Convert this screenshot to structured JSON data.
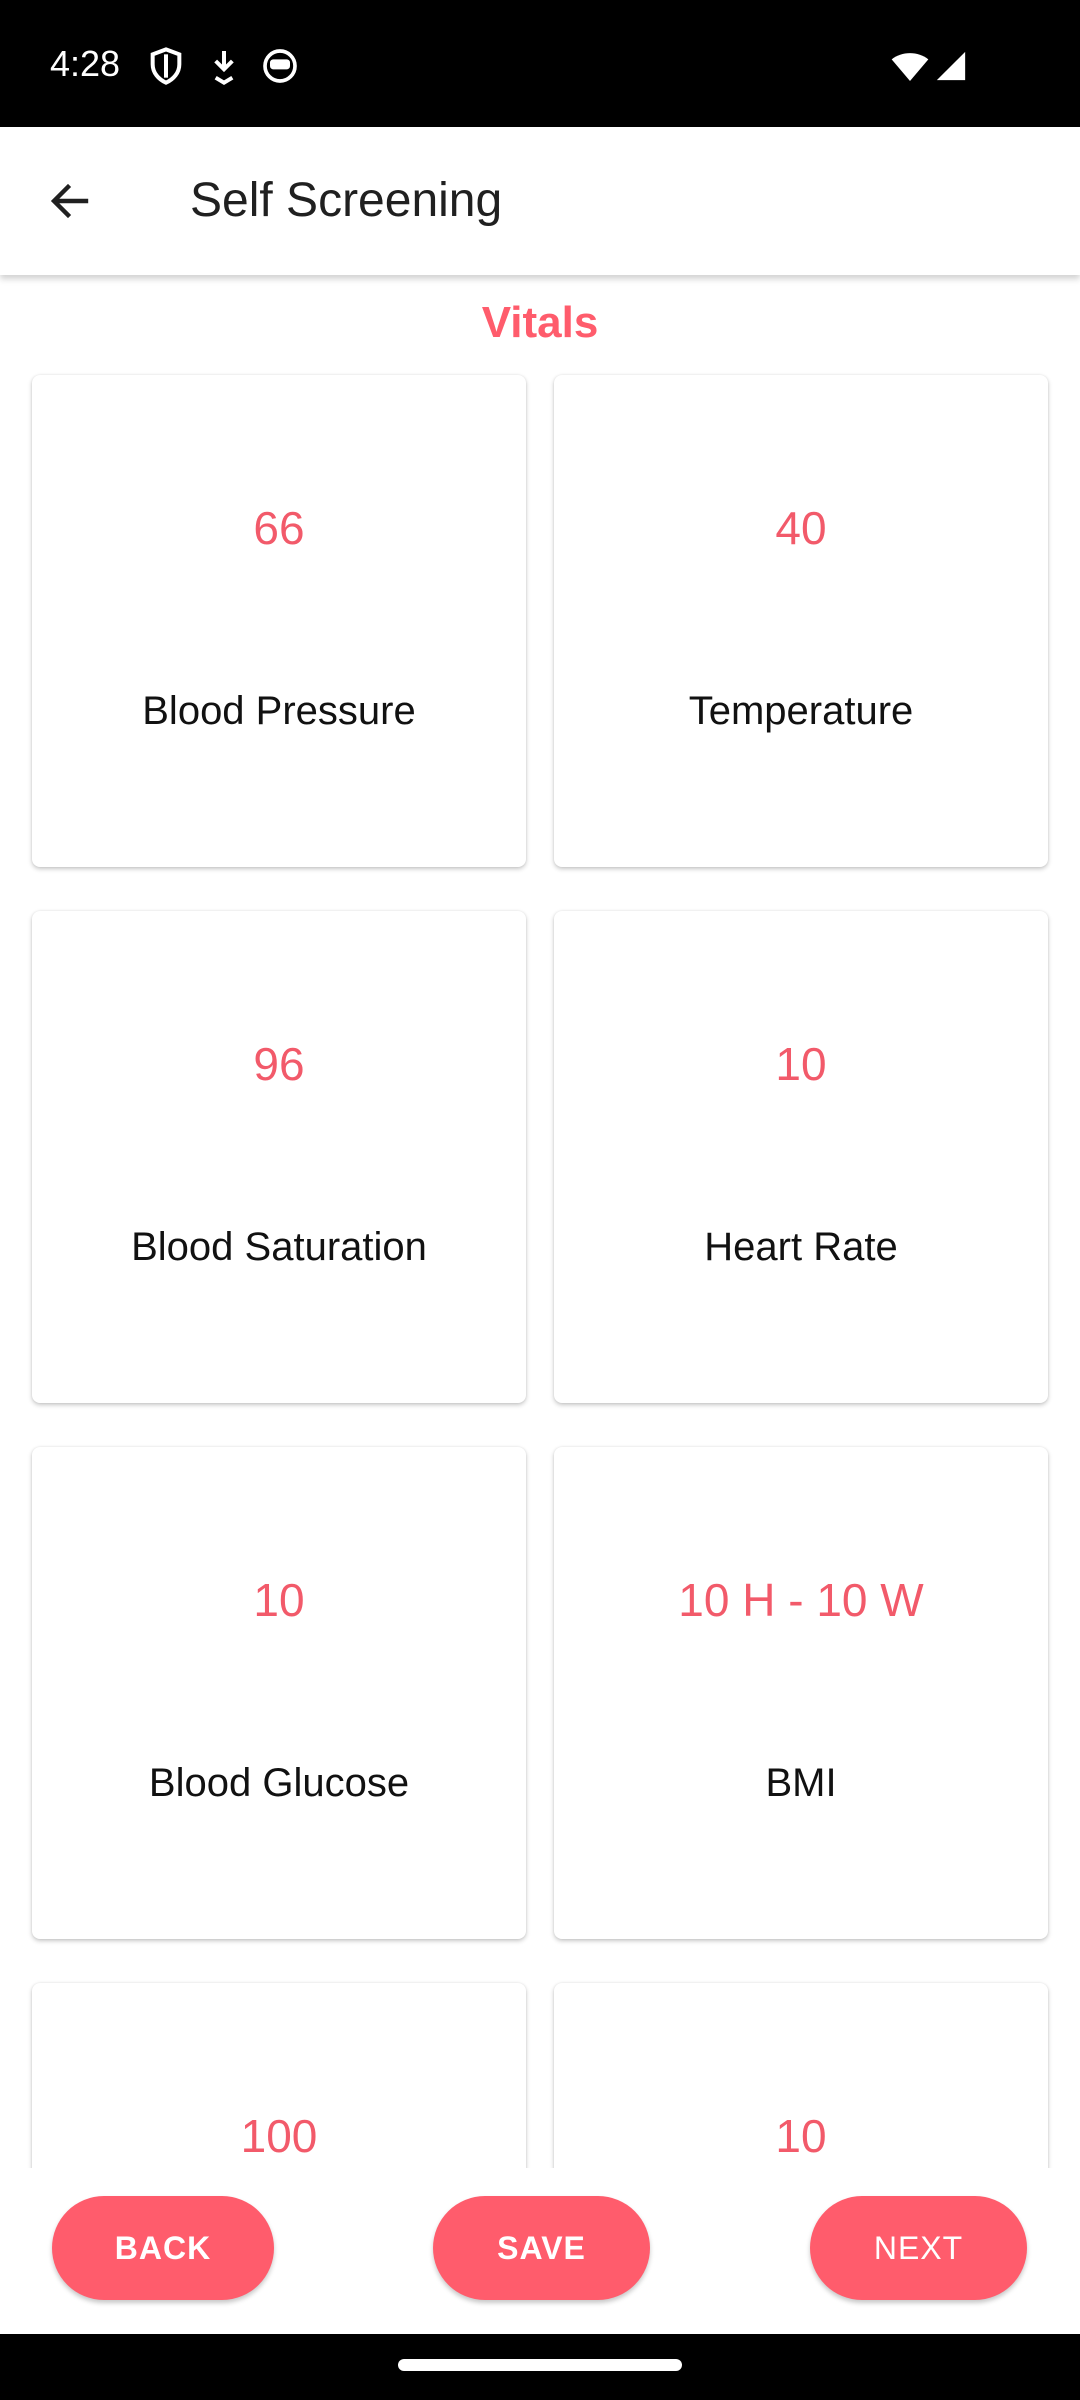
{
  "status_bar": {
    "time": "4:28",
    "icons": [
      "shield-icon",
      "download-icon",
      "face-icon",
      "wifi-icon",
      "signal-icon"
    ]
  },
  "app_bar": {
    "title": "Self Screening",
    "back_icon": "arrow-left-icon"
  },
  "section": {
    "title": "Vitals"
  },
  "cards": [
    {
      "value": "66",
      "label": "Blood Pressure"
    },
    {
      "value": "40",
      "label": "Temperature"
    },
    {
      "value": "96",
      "label": "Blood Saturation"
    },
    {
      "value": "10",
      "label": "Heart Rate"
    },
    {
      "value": "10",
      "label": "Blood Glucose"
    },
    {
      "value": "10 H - 10 W",
      "label": "BMI"
    },
    {
      "value": "100",
      "label": ""
    },
    {
      "value": "10",
      "label": ""
    }
  ],
  "buttons": {
    "back": "BACK",
    "save": "SAVE",
    "next": "NEXT"
  },
  "colors": {
    "accent": "#ff5c6c",
    "value_text": "#f25a6a",
    "status_bar": "#000000",
    "background": "#ffffff"
  }
}
